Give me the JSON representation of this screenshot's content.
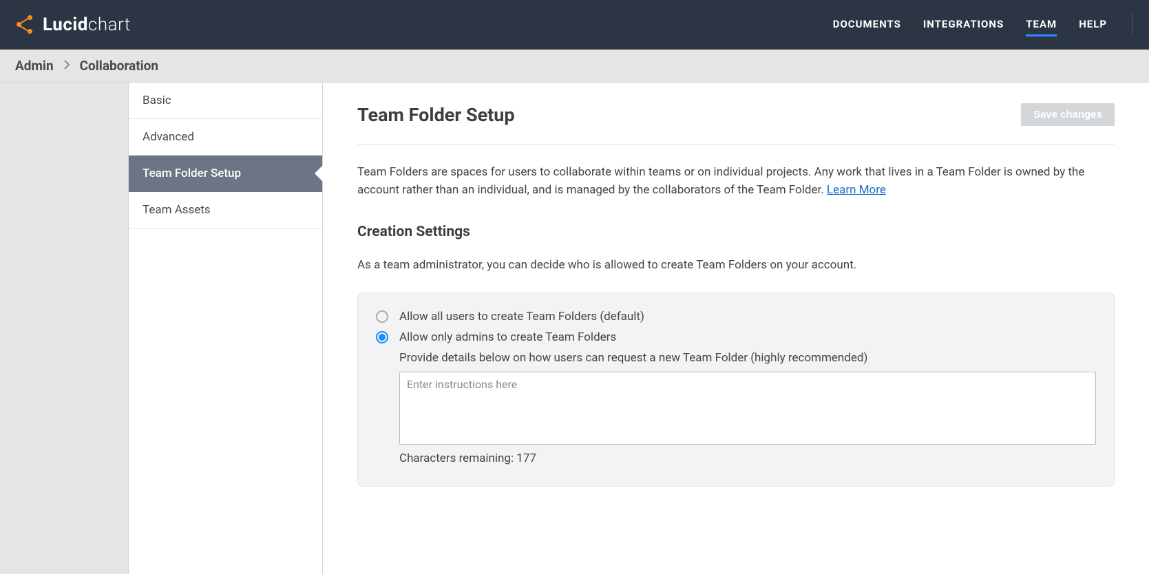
{
  "logo": {
    "bold": "Lucid",
    "thin": "chart"
  },
  "nav": {
    "documents": "DOCUMENTS",
    "integrations": "INTEGRATIONS",
    "team": "TEAM",
    "help": "HELP"
  },
  "breadcrumb": {
    "admin": "Admin",
    "collaboration": "Collaboration"
  },
  "sidebar": {
    "basic": "Basic",
    "advanced": "Advanced",
    "team_folder_setup": "Team Folder Setup",
    "team_assets": "Team Assets"
  },
  "main": {
    "title": "Team Folder Setup",
    "save_button": "Save changes",
    "description": "Team Folders are spaces for users to collaborate within teams or on individual projects. Any work that lives in a Team Folder is owned by the account rather than an individual, and is managed by the collaborators of the Team Folder. ",
    "learn_more": "Learn More",
    "creation_settings_title": "Creation Settings",
    "creation_settings_sub": "As a team administrator, you can decide who is allowed to create Team Folders on your account.",
    "radio_all_users": "Allow all users to create Team Folders (default)",
    "radio_admins_only": "Allow only admins to create Team Folders",
    "radio_admins_hint": "Provide details below on how users can request a new Team Folder (highly recommended)",
    "instructions_placeholder": "Enter instructions here",
    "characters_remaining_label": "Characters remaining: ",
    "characters_remaining_value": "177"
  }
}
